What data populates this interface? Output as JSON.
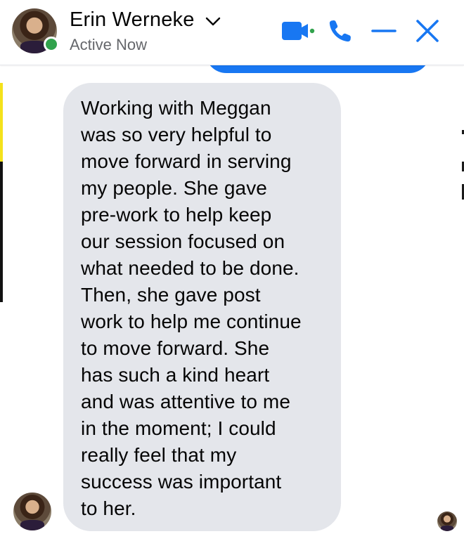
{
  "header": {
    "contact_name": "Erin Werneke",
    "status": "Active Now",
    "icons": [
      "video-call-icon",
      "phone-icon",
      "minimize-icon",
      "close-icon"
    ],
    "accent_color": "#1877f2",
    "online_color": "#31a24c"
  },
  "conversation": {
    "received_message": "Working with Meggan\nwas so very helpful to\nmove forward in serving\nmy people. She gave\npre-work to help keep\nour session focused on\nwhat needed to be done.\nThen, she gave post\nwork to help me continue\nto move forward. She\nhas such a kind heart\nand was attentive to me\nin the moment; I could\nreally feel that my\nsuccess was important\nto her.",
    "received_bubble_color": "#e4e6eb",
    "sent_bubble_color": "#1877f2"
  }
}
